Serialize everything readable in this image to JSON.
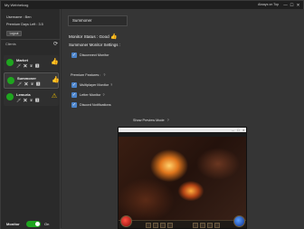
{
  "window": {
    "title": "My Webhelcog",
    "always_on_top": "Always on Top",
    "minimize": "—",
    "maximize": "☐",
    "close": "✕"
  },
  "sidebar": {
    "username": "Username : Ben",
    "premium_days": "Premium Days Left : 3.5",
    "logout_label": "Logout",
    "clients_label": "Clients",
    "clients": [
      {
        "name": "Market",
        "icons": "🗡 ✖ ♛ ⬆",
        "status": "thumbs-up",
        "status_glyph": "👍",
        "active": false
      },
      {
        "name": "Summoner",
        "icons": "🗡 ✖ ♛ ⬆",
        "status": "thumbs-up",
        "status_glyph": "👍",
        "active": true
      },
      {
        "name": "Lemuria",
        "icons": "🗡 ✖ ♛ ⬆",
        "status": "warning",
        "status_glyph": "⚠",
        "active": false
      }
    ],
    "monitor_label": "Monitor",
    "monitor_state": "On",
    "monitor_enabled": true
  },
  "main": {
    "selected_client": "Summoner",
    "monitor_status": "Monitor Status : Good",
    "settings_title": "Summoner Monitor Settings :",
    "disconnect_monitor": "Disconnect Monitor",
    "premium_features": "Premium Features :",
    "multiplayer_monitor": "Multiplayer Monitor",
    "letter_monitor": "Letter Monitor",
    "discord_notifications": "Discord Notifications",
    "preview_label": "Show Preview Mode",
    "question_mark": "?",
    "check_glyph": "✓"
  },
  "colors": {
    "accent_green": "#1fa51f",
    "checkbox_blue": "#4a82c8",
    "warning_yellow": "#f2c200"
  }
}
